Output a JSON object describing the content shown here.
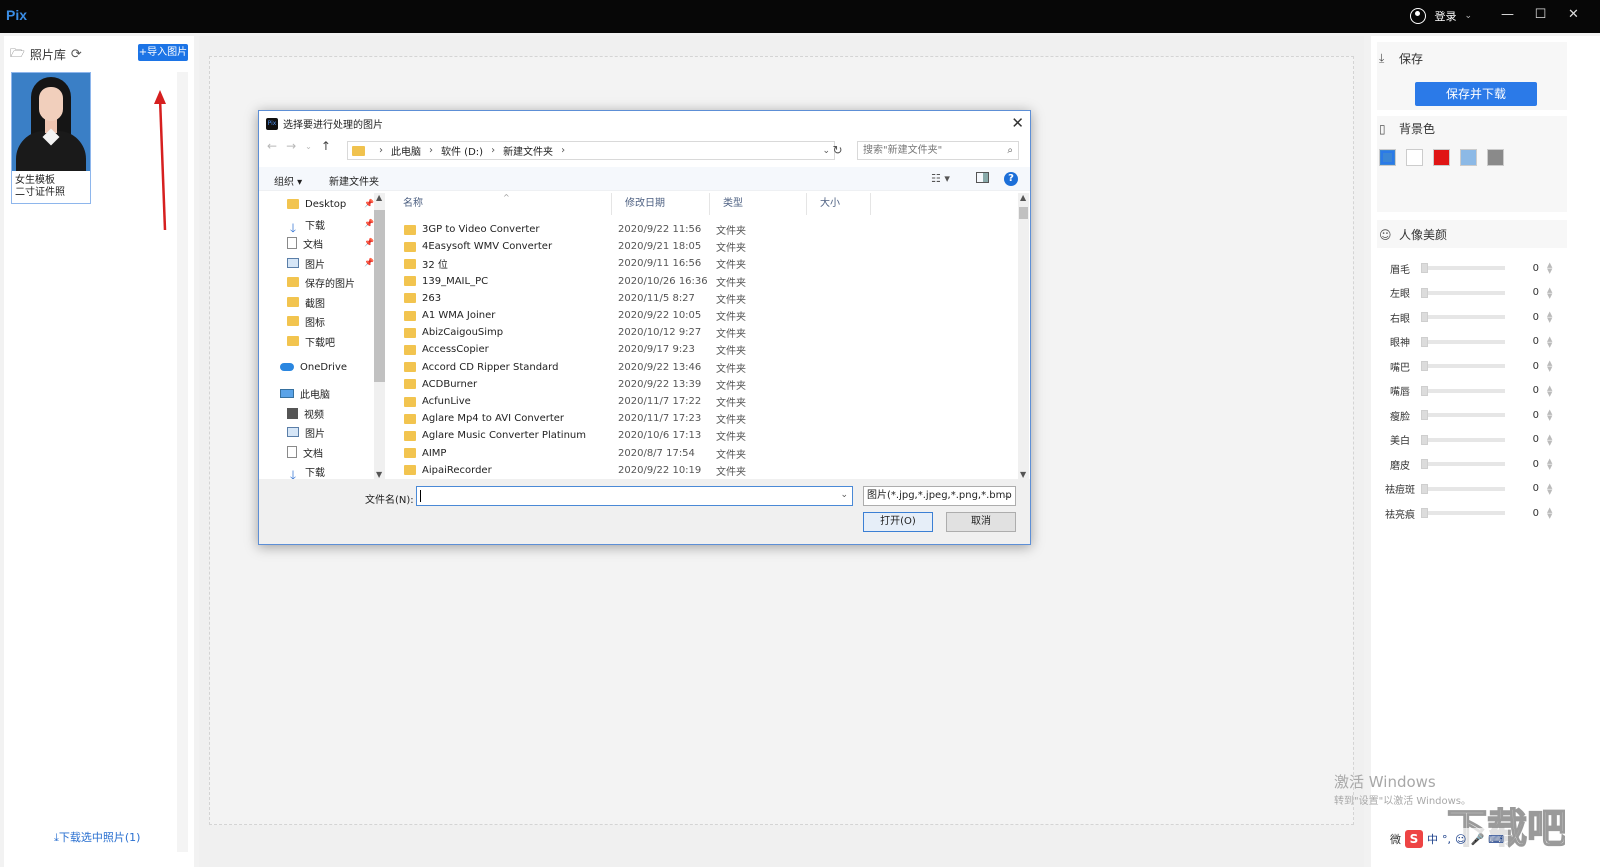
{
  "app": {
    "logo": "Pix",
    "login_label": "登录",
    "window_controls": [
      "—",
      "☐",
      "✕"
    ]
  },
  "left": {
    "title": "照片库",
    "import_button": "+导入图片",
    "thumb_title": "女生模板",
    "thumb_subtitle": "二寸证件照",
    "download_selected": "下载选中照片(1)"
  },
  "right": {
    "save_title": "保存",
    "save_button": "保存并下载",
    "bg_title": "背景色",
    "bg_colors": [
      "#3a86d6",
      "#ffffff",
      "#e01515",
      "#8cb9e6",
      "#8a8a8a"
    ],
    "beauty_title": "人像美颜",
    "sliders": [
      {
        "label": "眉毛",
        "value": "0"
      },
      {
        "label": "左眼",
        "value": "0"
      },
      {
        "label": "右眼",
        "value": "0"
      },
      {
        "label": "眼神",
        "value": "0"
      },
      {
        "label": "嘴巴",
        "value": "0"
      },
      {
        "label": "嘴唇",
        "value": "0"
      },
      {
        "label": "瘦脸",
        "value": "0"
      },
      {
        "label": "美白",
        "value": "0"
      },
      {
        "label": "磨皮",
        "value": "0"
      },
      {
        "label": "祛痘斑",
        "value": "0"
      },
      {
        "label": "祛亮痕",
        "value": "0"
      }
    ]
  },
  "overlay": {
    "watermark_line1": "激活 Windows",
    "watermark_line2": "转到\"设置\"以激活 Windows。",
    "brand": "下载吧",
    "ime": [
      "中",
      "°,",
      "☺",
      "🎤",
      "⌨"
    ],
    "footer_partial": "微"
  },
  "dialog": {
    "title": "选择要进行处理的图片",
    "close": "✕",
    "path": [
      "此电脑",
      "软件 (D:)",
      "新建文件夹"
    ],
    "search_placeholder": "搜索\"新建文件夹\"",
    "toolbar": {
      "organize": "组织 ▾",
      "new_folder": "新建文件夹"
    },
    "nav_items": [
      {
        "label": "Desktop",
        "icon": "folder",
        "pinned": true
      },
      {
        "label": "下载",
        "icon": "down",
        "pinned": true
      },
      {
        "label": "文档",
        "icon": "doc",
        "pinned": true
      },
      {
        "label": "图片",
        "icon": "pic",
        "pinned": true
      },
      {
        "label": "保存的图片",
        "icon": "folder",
        "pinned": false
      },
      {
        "label": "截图",
        "icon": "folder",
        "pinned": false
      },
      {
        "label": "图标",
        "icon": "folder",
        "pinned": false
      },
      {
        "label": "下载吧",
        "icon": "folder",
        "pinned": false
      },
      {
        "label": "OneDrive",
        "icon": "cloud",
        "pinned": false
      },
      {
        "label": "此电脑",
        "icon": "pc",
        "pinned": false
      },
      {
        "label": "视频",
        "icon": "video",
        "pinned": false
      },
      {
        "label": "图片",
        "icon": "pic",
        "pinned": false
      },
      {
        "label": "文档",
        "icon": "doc",
        "pinned": false
      },
      {
        "label": "下载",
        "icon": "down",
        "pinned": false
      }
    ],
    "columns": [
      "名称",
      "修改日期",
      "类型",
      "大小"
    ],
    "files": [
      {
        "name": "3GP to Video Converter",
        "date": "2020/9/22 11:56",
        "type": "文件夹"
      },
      {
        "name": "4Easysoft WMV Converter",
        "date": "2020/9/21 18:05",
        "type": "文件夹"
      },
      {
        "name": "32 位",
        "date": "2020/9/11 16:56",
        "type": "文件夹"
      },
      {
        "name": "139_MAIL_PC",
        "date": "2020/10/26 16:36",
        "type": "文件夹"
      },
      {
        "name": "263",
        "date": "2020/11/5 8:27",
        "type": "文件夹"
      },
      {
        "name": "A1 WMA Joiner",
        "date": "2020/9/22 10:05",
        "type": "文件夹"
      },
      {
        "name": "AbizCaigouSimp",
        "date": "2020/10/12 9:27",
        "type": "文件夹"
      },
      {
        "name": "AccessCopier",
        "date": "2020/9/17 9:23",
        "type": "文件夹"
      },
      {
        "name": "Accord CD Ripper Standard",
        "date": "2020/9/22 13:46",
        "type": "文件夹"
      },
      {
        "name": "ACDBurner",
        "date": "2020/9/22 13:39",
        "type": "文件夹"
      },
      {
        "name": "AcfunLive",
        "date": "2020/11/7 17:22",
        "type": "文件夹"
      },
      {
        "name": "Aglare Mp4 to AVI Converter",
        "date": "2020/11/7 17:23",
        "type": "文件夹"
      },
      {
        "name": "Aglare Music Converter Platinum",
        "date": "2020/10/6 17:13",
        "type": "文件夹"
      },
      {
        "name": "AIMP",
        "date": "2020/8/7 17:54",
        "type": "文件夹"
      },
      {
        "name": "AipaiRecorder",
        "date": "2020/9/22 10:19",
        "type": "文件夹"
      }
    ],
    "filename_label": "文件名(N):",
    "filename_value": "",
    "filter": "图片(*.jpg,*.jpeg,*.png,*.bmp",
    "open_button": "打开(O)",
    "cancel_button": "取消"
  }
}
